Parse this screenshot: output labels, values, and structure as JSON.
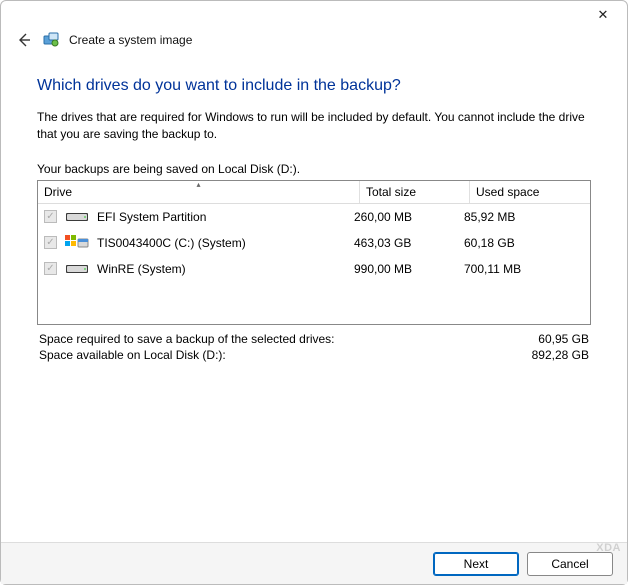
{
  "titlebar": {
    "close_glyph": "✕"
  },
  "header": {
    "wizard_title": "Create a system image"
  },
  "main": {
    "heading": "Which drives do you want to include in the backup?",
    "description": "The drives that are required for Windows to run will be included by default. You cannot include the drive that you are saving the backup to.",
    "saving_to": "Your backups are being saved on Local Disk (D:)."
  },
  "table": {
    "columns": {
      "drive": "Drive",
      "total": "Total size",
      "used": "Used space"
    },
    "rows": [
      {
        "checked": true,
        "disabled": true,
        "icon": "hdd",
        "name": "EFI System Partition",
        "total": "260,00 MB",
        "used": "85,92 MB"
      },
      {
        "checked": true,
        "disabled": true,
        "icon": "system",
        "name": "TIS0043400C (C:) (System)",
        "total": "463,03 GB",
        "used": "60,18 GB"
      },
      {
        "checked": true,
        "disabled": true,
        "icon": "hdd",
        "name": "WinRE (System)",
        "total": "990,00 MB",
        "used": "700,11 MB"
      }
    ]
  },
  "summary": {
    "required_label": "Space required to save a backup of the selected drives:",
    "required_value": "60,95 GB",
    "available_label": "Space available on Local Disk (D:):",
    "available_value": "892,28 GB"
  },
  "footer": {
    "next": "Next",
    "cancel": "Cancel"
  },
  "watermark": "XDA"
}
